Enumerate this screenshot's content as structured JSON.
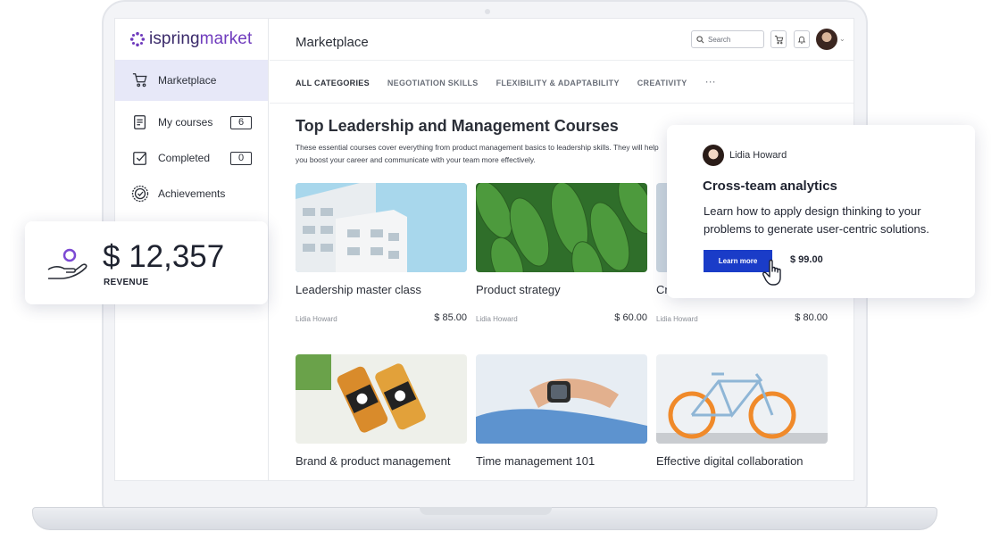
{
  "logo": {
    "prefix": "ispring",
    "suffix": "market"
  },
  "sidebar": {
    "items": [
      {
        "label": "Marketplace",
        "icon": "cart-icon",
        "active": true
      },
      {
        "label": "My courses",
        "icon": "courses-icon",
        "count": "6"
      },
      {
        "label": "Completed",
        "icon": "checkbox-icon",
        "count": "0"
      },
      {
        "label": "Achievements",
        "icon": "badge-icon"
      }
    ]
  },
  "header": {
    "title": "Marketplace",
    "search_placeholder": "Search"
  },
  "categories": [
    "ALL CATEGORIES",
    "NEGOTIATION SKILLS",
    "FLEXIBILITY & ADAPTABILITY",
    "CREATIVITY"
  ],
  "categories_more": "···",
  "section": {
    "title": "Top Leadership and Management Courses",
    "description": "These essential courses cover everything from product management basics to leadership skills. They will help you boost your career and communicate with your team more effectively."
  },
  "courses": [
    {
      "title": "Leadership master class",
      "author": "Lidia Howard",
      "price": "$ 85.00",
      "image": "building"
    },
    {
      "title": "Product strategy",
      "author": "Lidia Howard",
      "price": "$ 60.00",
      "image": "leaves"
    },
    {
      "title": "Cr",
      "author": "Lidia Howard",
      "price": "$ 80.00",
      "image": "office"
    },
    {
      "title": "Brand & product management",
      "image": "bottles"
    },
    {
      "title": "Time management 101",
      "image": "smartwatch"
    },
    {
      "title": "Effective digital collaboration",
      "image": "bicycle"
    }
  ],
  "revenue": {
    "amount": "$ 12,357",
    "label": "REVENUE"
  },
  "promo": {
    "author": "Lidia Howard",
    "title": "Cross-team analytics",
    "text": "Learn how to apply design thinking to your problems to generate user-centric solutions.",
    "button": "Learn more",
    "price": "$ 99.00"
  },
  "colors": {
    "accent": "#6f3bbd",
    "button": "#1a3cc8",
    "active_nav": "#e7e8f8"
  }
}
